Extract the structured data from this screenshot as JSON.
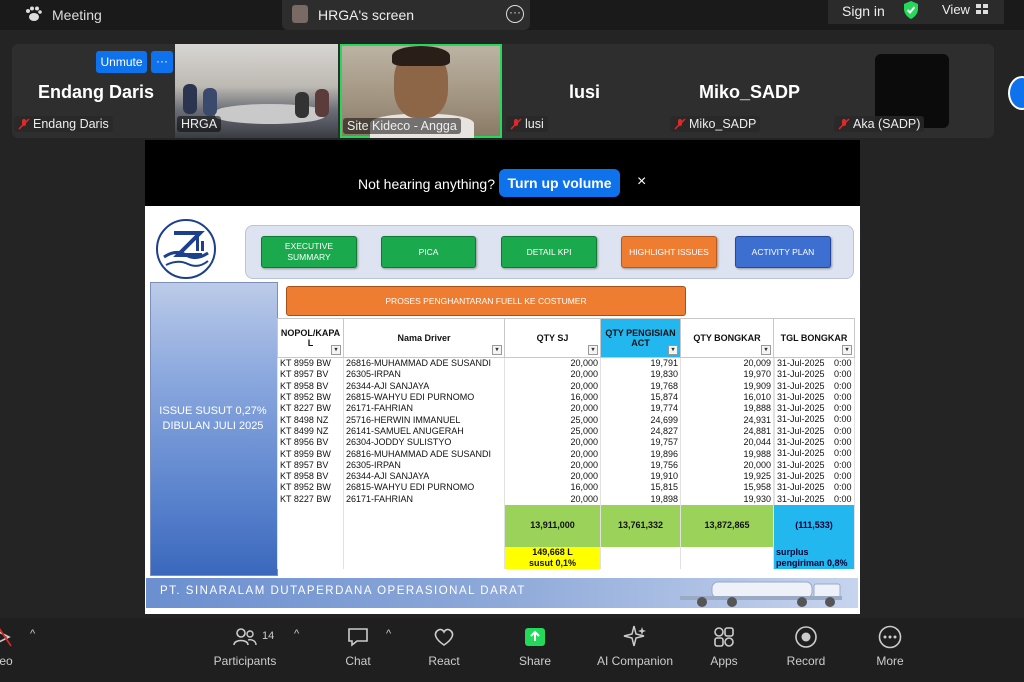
{
  "topbar": {
    "meeting_label": "Meeting",
    "screen_label": "HRGA's screen",
    "sign_in": "Sign in",
    "view": "View"
  },
  "participants_strip": {
    "endang": {
      "big_name": "Endang Daris",
      "tag": "Endang Daris",
      "unmute": "Unmute",
      "more": "···"
    },
    "hrga": {
      "tag": "HRGA"
    },
    "angga": {
      "tag": "Site Kideco - Angga"
    },
    "lusi": {
      "big_name": "lusi",
      "tag": "lusi"
    },
    "miko": {
      "big_name": "Miko_SADP",
      "tag": "Miko_SADP"
    },
    "aka": {
      "tag": "Aka (SADP)"
    }
  },
  "audio_banner": {
    "text": "Not hearing anything?",
    "button": "Turn up volume",
    "close": "×"
  },
  "dashboard": {
    "nav": {
      "executive_1": "EXECUTIVE",
      "executive_2": "SUMMARY",
      "pica": "PICA",
      "detail_kpi": "DETAIL KPI",
      "highlight": "HIGHLIGHT ISSUES",
      "activity": "ACTIVITY PLAN"
    },
    "issue_1": "ISSUE SUSUT 0,27%",
    "issue_2": "DIBULAN JULI 2025",
    "proses": "PROSES PENGHANTARAN FUELL KE COSTUMER",
    "headers": {
      "nopol_1": "NOPOL/KAPA",
      "nopol_2": "L",
      "driver": "Nama Driver",
      "qty_sj": "QTY SJ",
      "qty_isi_1": "QTY PENGISIAN",
      "qty_isi_2": "ACT",
      "qty_bongkar": "QTY BONGKAR",
      "tgl": "TGL BONGKAR"
    },
    "rows": [
      [
        "KT 8959 BW",
        "26816-MUHAMMAD ADE SUSANDI",
        "20,000",
        "19,791",
        "20,009",
        "31-Jul-2025",
        "0:00"
      ],
      [
        "KT 8957 BV",
        "26305-IRPAN",
        "20,000",
        "19,830",
        "19,970",
        "31-Jul-2025",
        "0:00"
      ],
      [
        "KT 8958 BV",
        "26344-AJI SANJAYA",
        "20,000",
        "19,768",
        "19,909",
        "31-Jul-2025",
        "0:00"
      ],
      [
        "KT 8952 BW",
        "26815-WAHYU EDI PURNOMO",
        "16,000",
        "15,874",
        "16,010",
        "31-Jul-2025",
        "0:00"
      ],
      [
        "KT 8227 BW",
        "26171-FAHRIAN",
        "20,000",
        "19,774",
        "19,888",
        "31-Jul-2025",
        "0:00"
      ],
      [
        "KT 8498 NZ",
        "25716-HERWIN IMMANUEL",
        "25,000",
        "24,699",
        "24,931",
        "31-Jul-2025",
        "0:00"
      ],
      [
        "KT 8499 NZ",
        "26141-SAMUEL ANUGERAH",
        "25,000",
        "24,827",
        "24,881",
        "31-Jul-2025",
        "0:00"
      ],
      [
        "KT 8956 BV",
        "26304-JODDY SULISTYO",
        "20,000",
        "19,757",
        "20,044",
        "31-Jul-2025",
        "0:00"
      ],
      [
        "KT 8959 BW",
        "26816-MUHAMMAD ADE SUSANDI",
        "20,000",
        "19,896",
        "19,988",
        "31-Jul-2025",
        "0:00"
      ],
      [
        "KT 8957 BV",
        "26305-IRPAN",
        "20,000",
        "19,756",
        "20,000",
        "31-Jul-2025",
        "0:00"
      ],
      [
        "KT 8958 BV",
        "26344-AJI SANJAYA",
        "20,000",
        "19,910",
        "19,925",
        "31-Jul-2025",
        "0:00"
      ],
      [
        "KT 8952 BW",
        "26815-WAHYU EDI PURNOMO",
        "16,000",
        "15,815",
        "15,958",
        "31-Jul-2025",
        "0:00"
      ],
      [
        "KT 8227 BW",
        "26171-FAHRIAN",
        "20,000",
        "19,898",
        "19,930",
        "31-Jul-2025",
        "0:00"
      ]
    ],
    "totals": {
      "qty_sj": "13,911,000",
      "qty_isi": "13,761,332",
      "qty_bongkar": "13,872,865",
      "diff": "(111,533)"
    },
    "notes": {
      "susut_1": "149,668 L",
      "susut_2": "susut 0,1%",
      "surplus_1": "surplus",
      "surplus_2": "pengiriman 0,8%"
    },
    "company": "PT. SINARALAM DUTAPERDANA OPERASIONAL DARAT"
  },
  "toolbar": {
    "video_partial": "eo",
    "participants": "Participants",
    "participants_count": "14",
    "chat": "Chat",
    "react": "React",
    "share": "Share",
    "ai": "AI Companion",
    "apps": "Apps",
    "record": "Record",
    "more": "More"
  },
  "colors": {
    "zoom_blue": "#0e72ed",
    "active_speaker": "#23d959",
    "share_green": "#23d959",
    "btn_green": "#1aa94c",
    "btn_orange": "#ee7d31",
    "btn_blue": "#3d6fd0",
    "highlight_cyan": "#22b7ef",
    "total_green": "#9bd25a",
    "note_yellow": "#ffff00"
  }
}
